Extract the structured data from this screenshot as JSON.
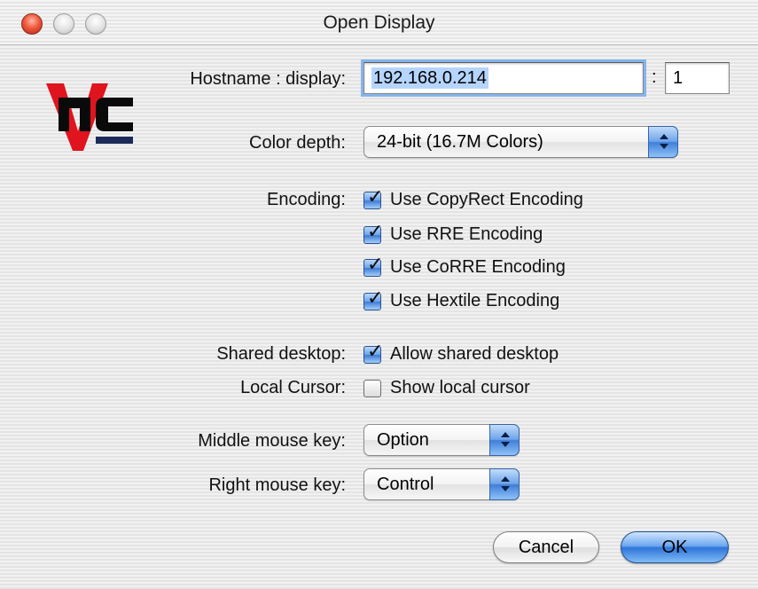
{
  "window": {
    "title": "Open Display"
  },
  "logo": {
    "name": "vnc-logo",
    "text": "VNC"
  },
  "host": {
    "label": "Hostname : display:",
    "hostname_value": "192.168.0.214",
    "separator": ":",
    "display_value": "1"
  },
  "color_depth": {
    "label": "Color depth:",
    "selected": "24-bit (16.7M Colors)"
  },
  "encoding": {
    "label": "Encoding:",
    "options": [
      {
        "label": "Use CopyRect Encoding",
        "checked": true
      },
      {
        "label": "Use RRE Encoding",
        "checked": true
      },
      {
        "label": "Use CoRRE Encoding",
        "checked": true
      },
      {
        "label": "Use Hextile Encoding",
        "checked": true
      }
    ]
  },
  "shared_desktop": {
    "label": "Shared desktop:",
    "option": "Allow shared desktop",
    "checked": true
  },
  "local_cursor": {
    "label": "Local Cursor:",
    "option": "Show local cursor",
    "checked": false
  },
  "middle_mouse": {
    "label": "Middle mouse key:",
    "selected": "Option"
  },
  "right_mouse": {
    "label": "Right mouse key:",
    "selected": "Control"
  },
  "buttons": {
    "cancel": "Cancel",
    "ok": "OK"
  },
  "colors": {
    "accent": "#3f7fd9",
    "close": "#f05a3c",
    "logo_red": "#e0141e",
    "logo_navy": "#1c2a5a"
  }
}
